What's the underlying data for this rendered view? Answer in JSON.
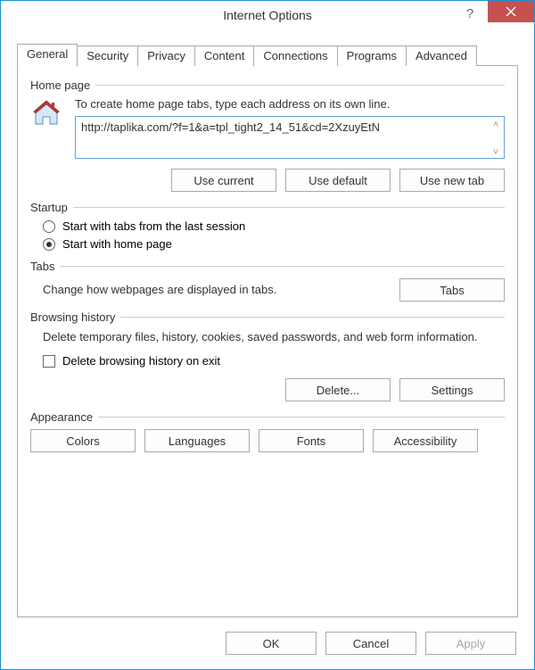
{
  "title": "Internet Options",
  "tabs": [
    "General",
    "Security",
    "Privacy",
    "Content",
    "Connections",
    "Programs",
    "Advanced"
  ],
  "homepage": {
    "label": "Home page",
    "desc": "To create home page tabs, type each address on its own line.",
    "value": "http://taplika.com/?f=1&a=tpl_tight2_14_51&cd=2XzuyEtN",
    "use_current": "Use current",
    "use_default": "Use default",
    "use_new_tab": "Use new tab"
  },
  "startup": {
    "label": "Startup",
    "opt1": "Start with tabs from the last session",
    "opt2": "Start with home page"
  },
  "tabsg": {
    "label": "Tabs",
    "desc": "Change how webpages are displayed in tabs.",
    "btn": "Tabs"
  },
  "history": {
    "label": "Browsing history",
    "desc": "Delete temporary files, history, cookies, saved passwords, and web form information.",
    "chk": "Delete browsing history on exit",
    "del": "Delete...",
    "set": "Settings"
  },
  "appearance": {
    "label": "Appearance",
    "colors": "Colors",
    "languages": "Languages",
    "fonts": "Fonts",
    "accessibility": "Accessibility"
  },
  "footer": {
    "ok": "OK",
    "cancel": "Cancel",
    "apply": "Apply"
  }
}
